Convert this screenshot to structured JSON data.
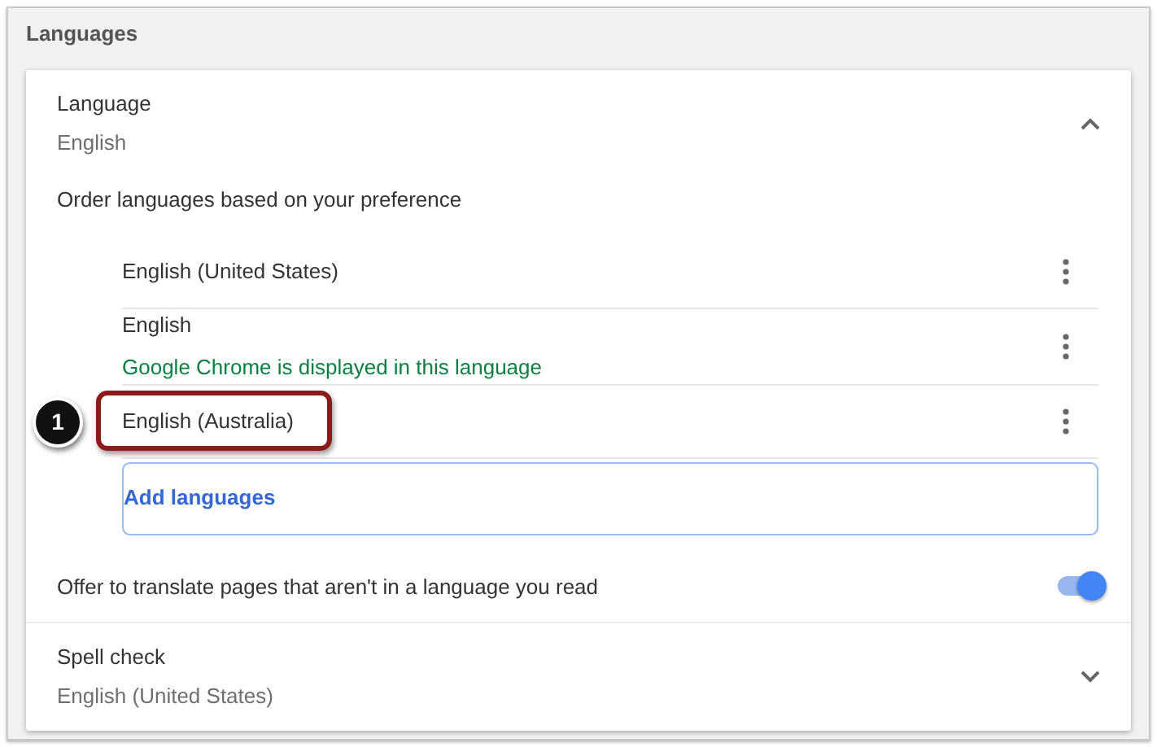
{
  "section_title": "Languages",
  "language": {
    "title": "Language",
    "value": "English",
    "expanded": true
  },
  "order_hint": "Order languages based on your preference",
  "languages": [
    {
      "name": "English (United States)",
      "highlighted": false
    },
    {
      "name": "English",
      "note": "Google Chrome is displayed in this language",
      "highlighted": false
    },
    {
      "name": "English (Australia)",
      "highlighted": true,
      "callout": "1"
    }
  ],
  "add_button": "Add languages",
  "translate": {
    "label": "Offer to translate pages that aren't in a language you read",
    "on": true
  },
  "spell_check": {
    "title": "Spell check",
    "value": "English (United States)",
    "expanded": false
  }
}
